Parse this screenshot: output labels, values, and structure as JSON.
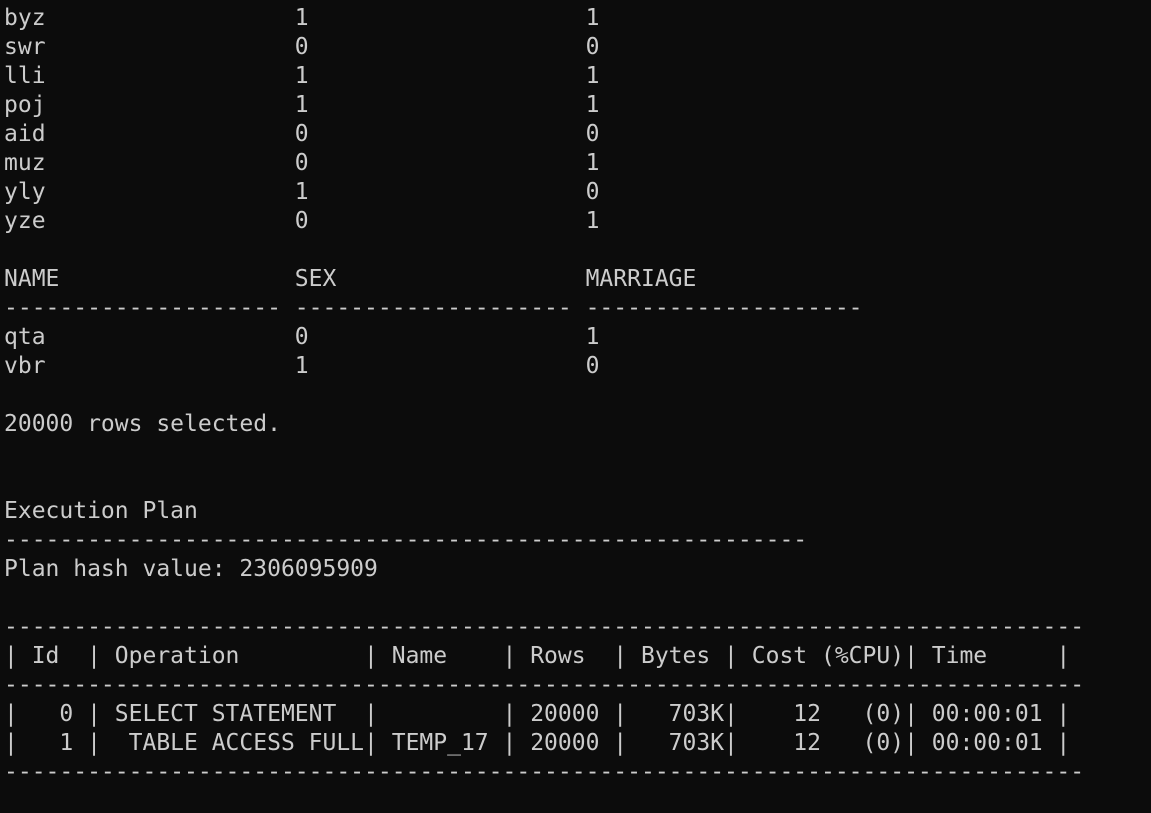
{
  "terminal": {
    "lines": [
      "byz                  1                    1",
      "swr                  0                    0",
      "lli                  1                    1",
      "poj                  1                    1",
      "aid                  0                    0",
      "muz                  0                    1",
      "yly                  1                    0",
      "yze                  0                    1",
      "",
      "NAME                 SEX                  MARRIAGE",
      "-------------------- -------------------- --------------------",
      "qta                  0                    1",
      "vbr                  1                    0",
      "",
      "20000 rows selected.",
      "",
      "",
      "Execution Plan",
      "----------------------------------------------------------",
      "Plan hash value: 2306095909",
      "",
      "------------------------------------------------------------------------------",
      "| Id  | Operation         | Name    | Rows  | Bytes | Cost (%CPU)| Time     |",
      "------------------------------------------------------------------------------",
      "|   0 | SELECT STATEMENT  |         | 20000 |   703K|    12   (0)| 00:00:01 |",
      "|   1 |  TABLE ACCESS FULL| TEMP_17 | 20000 |   703K|    12   (0)| 00:00:01 |",
      "------------------------------------------------------------------------------"
    ]
  },
  "colors": {
    "background": "#0c0c0c",
    "text": "#cccccc"
  }
}
